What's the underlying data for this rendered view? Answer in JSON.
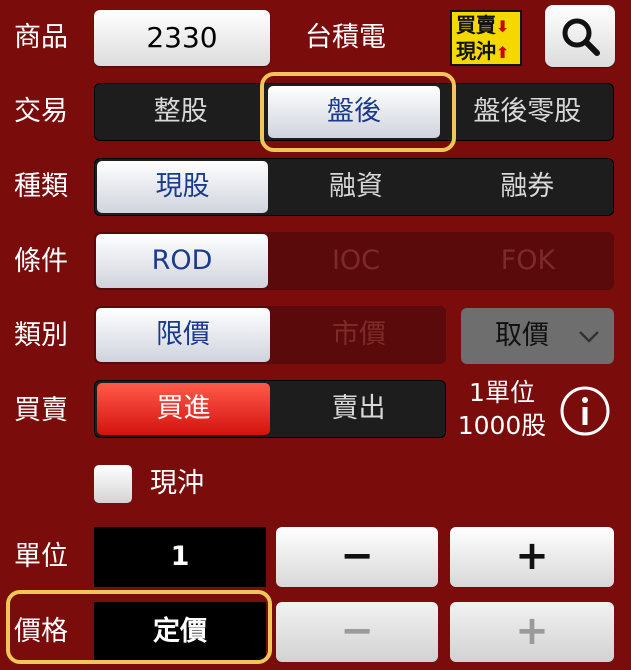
{
  "rows": {
    "product": {
      "label": "商品",
      "code": "2330",
      "name": "台積電"
    },
    "trade": {
      "label": "交易",
      "options": [
        "整股",
        "盤後",
        "盤後零股"
      ],
      "selected": "盤後"
    },
    "kind": {
      "label": "種類",
      "options": [
        "現股",
        "融資",
        "融券"
      ],
      "selected": "現股"
    },
    "condition": {
      "label": "條件",
      "options": [
        "ROD",
        "IOC",
        "FOK"
      ],
      "selected": "ROD"
    },
    "category": {
      "label": "類別",
      "options": [
        "限價",
        "市價"
      ],
      "selected": "限價",
      "price_select": "取價"
    },
    "side": {
      "label": "買賣",
      "options": [
        "買進",
        "賣出"
      ],
      "selected": "買進",
      "unit_info_line1": "1單位",
      "unit_info_line2": "1000股"
    },
    "daytrade": {
      "label": "現沖",
      "checked": false
    },
    "unit": {
      "label": "單位",
      "value": "1",
      "minus": "−",
      "plus": "+"
    },
    "price": {
      "label": "價格",
      "value": "定價",
      "minus": "−",
      "plus": "+"
    }
  },
  "toggle_icon": {
    "line1": "買賣",
    "line2": "現沖",
    "arrow1": "⬇",
    "arrow2": "⬆"
  },
  "colors": {
    "background": "#7a0c0c",
    "highlight": "#f0c55a",
    "buy": "#e8221f",
    "selected_text": "#1a3a8c"
  },
  "icons": {
    "search": "search-icon",
    "info": "info-icon",
    "chevron": "chevron-down-icon"
  }
}
